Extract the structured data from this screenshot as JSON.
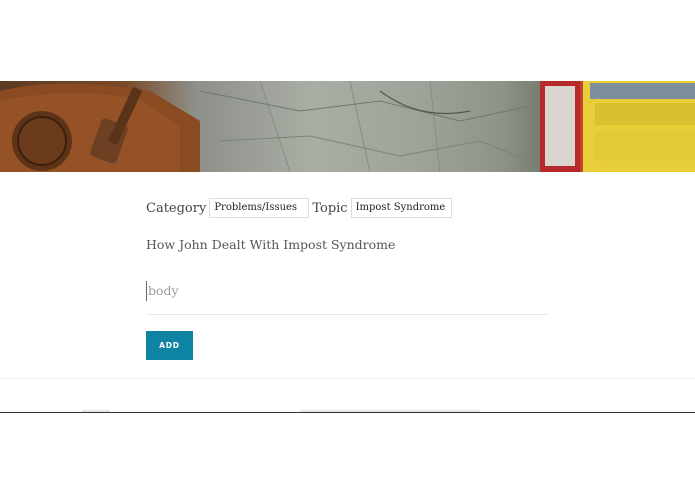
{
  "header_image": {
    "alt": "travel map and backpack banner"
  },
  "form": {
    "category_label": "Category",
    "category_value": "Problems/Issues",
    "topic_label": "Topic",
    "topic_value": "Impost Syndrome",
    "title_value": "How John Dealt With Impost Syndrome",
    "body_placeholder": "body",
    "add_label": "ADD"
  },
  "colors": {
    "accent": "#0f83a3"
  }
}
